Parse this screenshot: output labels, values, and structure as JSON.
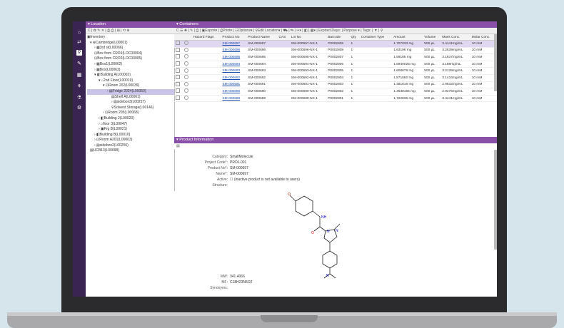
{
  "location": {
    "title": "Location",
    "toolbar": "C | ✿ ✎ ✕ | ⎙ ⎙ | ⊞ | ⟲ ⊕",
    "tree": [
      {
        "label": "▣Inventory"
      },
      {
        "label": "▾ ⊕Cambridge(L00001)"
      },
      {
        "label": "› ▦3rd st(L00066)"
      },
      {
        "label": "⊡Box from CRO1(LOC00004)"
      },
      {
        "label": "⊡Box from CRO2(LOC00005)"
      },
      {
        "label": "› ▦Box1(L00062)"
      },
      {
        "label": "› ▦Box(L00063)"
      },
      {
        "label": "▾ ◧Building A(L00002)"
      },
      {
        "label": "▾ ⌂2nd Floor(L00019)"
      },
      {
        "label": "▾ ⊡Room 202(L00039)"
      },
      {
        "label": "› ▤Fridge 2024(L00050)"
      },
      {
        "label": "▤Shelf A(L00061)"
      },
      {
        "label": "› ▤sidebox3(L00257)"
      },
      {
        "label": "⚲Solvent Storage(L00146)"
      },
      {
        "label": "› ⊡Room 205(L00068)"
      },
      {
        "label": "› ◧Building 2(L00023)"
      },
      {
        "label": "› ⌂floor 3(L00047)"
      },
      {
        "label": "› ▣Frg B(L00021)"
      },
      {
        "label": "› ◧Building B(L00010)"
      },
      {
        "label": "› ⊡Room A201(L00003)"
      },
      {
        "label": "› ▤sidebox2(L00256)"
      },
      {
        "label": "▤UCB13(L00098)"
      }
    ]
  },
  "containers": {
    "title": "Containers",
    "toolbar": "C ☰ ✚ | ✎ | ⎙ | ▣Export▾ | ⎙Print▾ | ☷Options▾ | ⚲Edit Location▾ | ⛟ | ⇆ | ✈▾ | ◧ | ▦▾ | Expired Days:      | Purpose ▾ | Tags:      | ▼ | ⚲",
    "columns": [
      "",
      "",
      "Hazard Flags",
      "Product No",
      "Product Name",
      "CAS",
      "Lot No",
      "Barcode",
      "Qty",
      "Container Type",
      "Amount",
      "Volume",
      "Mass Conc.",
      "Molar Conc."
    ],
    "rows": [
      [
        "SM-000697",
        "SM-000697",
        "",
        "SM-000697-NX-1",
        "P0002809",
        "1",
        "",
        "1.707033 mg",
        "500 µL",
        "3.4141mg/mL",
        "10 mM"
      ],
      [
        "SM-000696",
        "SM-000696",
        "",
        "SM-000696-NX-1",
        "P0002808",
        "1",
        "",
        "1.63196 mg",
        "500 µL",
        "3.2639mg/mL",
        "10 mM"
      ],
      [
        "SM-000695",
        "SM-000695",
        "",
        "SM-000695-NX-1",
        "P0002807",
        "1",
        "",
        "1.59185 mg",
        "500 µL",
        "3.1837mg/mL",
        "10 mM"
      ],
      [
        "SM-000694",
        "SM-000694",
        "",
        "SM-000694-NX-1",
        "P0002806",
        "1",
        "",
        "1.5940025 mg",
        "500 µL",
        "3.188mg/mL",
        "10 mM"
      ],
      [
        "SM-000693",
        "SM-000693",
        "",
        "SM-000693-NX-1",
        "P0002805",
        "1",
        "",
        "1.606878 mg",
        "500 µL",
        "3.2138mg/mL",
        "10 mM"
      ],
      [
        "SM-000692",
        "SM-000692",
        "",
        "SM-000692-NX-1",
        "P0002804",
        "1",
        "",
        "1.571692 mg",
        "500 µL",
        "3.1434mg/mL",
        "10 mM"
      ],
      [
        "SM-000691",
        "SM-000691",
        "",
        "SM-000691-NX-1",
        "P0002803",
        "1",
        "",
        "1.481616 mg",
        "500 µL",
        "2.9632mg/mL",
        "10 mM"
      ],
      [
        "SM-000690",
        "SM-000690",
        "",
        "SM-000690-NX-1",
        "P0002802",
        "1",
        "",
        "1.4638165 mg",
        "500 µL",
        "2.9276mg/mL",
        "10 mM"
      ],
      [
        "SM-000689",
        "SM-000689",
        "",
        "SM-000689-NX-1",
        "P0002801",
        "1",
        "",
        "1.722036 mg",
        "500 µL",
        "3.4441mg/mL",
        "10 mM"
      ]
    ]
  },
  "product": {
    "title": "Product Information",
    "fields": {
      "category_label": "Category:",
      "category": "SmallMolecule",
      "project_label": "Project Code*:",
      "project": "PROJ-001",
      "product_no_label": "Product No*:",
      "product_no": "SM-000697",
      "name_label": "Name*:",
      "name": "SM-000697",
      "active_label": "Active:",
      "active": "☐ (inactive product is not available to users)",
      "structure_label": "Structure:",
      "mw_label": "MW:",
      "mw": "341.4066",
      "mf_label": "MF:",
      "mf": "C18H23N5O2",
      "synonyms_label": "Synonyms:"
    }
  },
  "colors": {
    "header": "#8a4fa6",
    "sidebar": "#3a2452",
    "selected": "#c9c4e8"
  }
}
